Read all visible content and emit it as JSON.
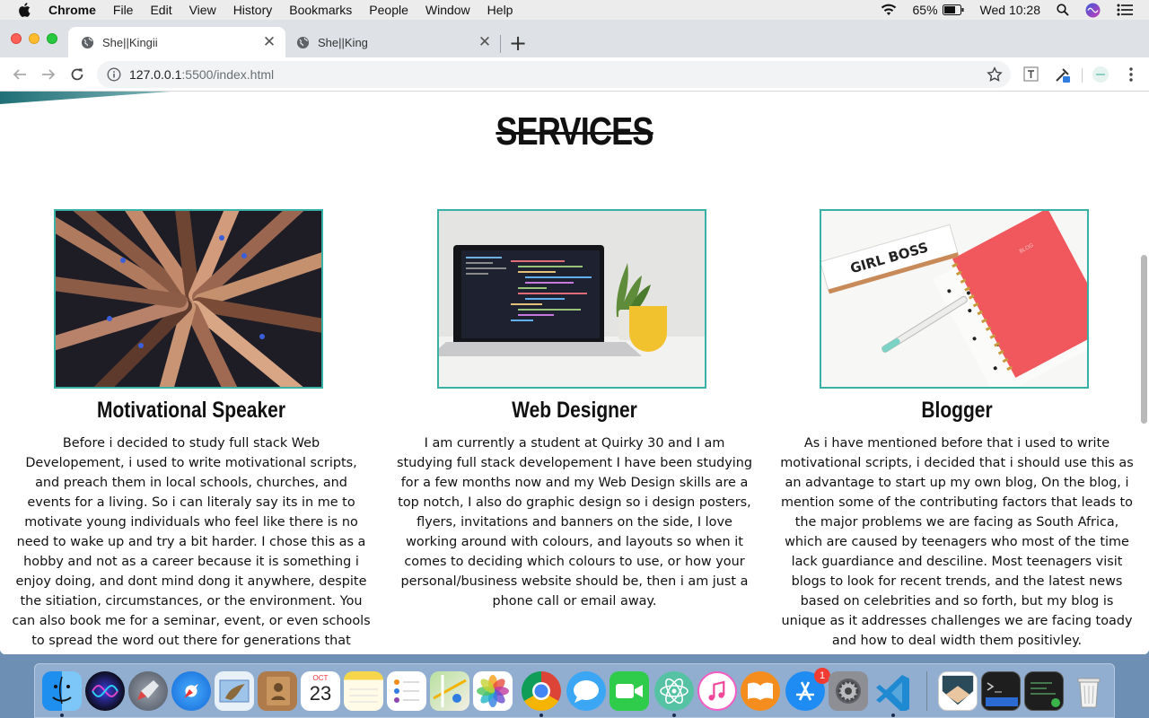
{
  "menubar": {
    "app": "Chrome",
    "items": [
      "File",
      "Edit",
      "View",
      "History",
      "Bookmarks",
      "People",
      "Window",
      "Help"
    ],
    "battery": "65%",
    "clock": "Wed 10:28"
  },
  "browser": {
    "tabs": [
      {
        "title": "She||Kingii",
        "active": true
      },
      {
        "title": "She||King",
        "active": false
      }
    ],
    "url_host": "127.0.0.1",
    "url_rest": ":5500/index.html"
  },
  "page": {
    "section_title": "SERVICES",
    "cards": [
      {
        "title": "Motivational Speaker",
        "image": "hands-together-photo",
        "lines": [
          "Before i decided to study full stack Web",
          "Developement, i used to write motivational scripts,",
          "and preach them in local schools, churches, and",
          "events for a living. So i can literaly say its in me to",
          "motivate young individuals who feel like there is no",
          "need to wake up and try a bit harder. I chose this as a",
          "hobby and not as a career because it is something i",
          "enjoy doing, and dont mind dong it anywhere, despite",
          "the sitiation, circumstances, or the environment. You",
          "can also book me for a seminar, event, or even schools",
          "to spread the word out there for generations that"
        ]
      },
      {
        "title": "Web Designer",
        "image": "laptop-code-photo",
        "lines": [
          "I am currently a student at Quirky 30 and I am",
          "studying full stack developement I have been studying",
          "for a few months now and my Web Design skills are a",
          "top notch, I also do graphic design so i design posters,",
          "flyers, invitations and banners on the side, I love",
          "working around with colours, and layouts so when it",
          "comes to deciding which colours to use, or how your",
          "personal/business website should be, then i am just a",
          "phone call or email away."
        ]
      },
      {
        "title": "Blogger",
        "image": "girl-boss-notebook-photo",
        "lines": [
          "As i have mentioned before that i used to write",
          "motivational scripts, i decided that i should use this as",
          "an advantage to start up my own blog, On the blog, i",
          "mention some of the contributing factors that leads to",
          "the major problems we are facing as South Africa,",
          "which are caused by teenagers who most of the time",
          "lack guardiance and desciline. Most teenagers visit",
          "blogs to look for recent trends, and the latest news",
          "based on celebrities and so forth, but my blog is",
          "unique as it addresses challenges we are facing toady",
          "and how to deal width them positivley."
        ]
      }
    ],
    "image_text": {
      "desk_sign": "GIRL BOSS",
      "notebook": "BLOG"
    }
  },
  "dock": {
    "apps": [
      "Finder",
      "Siri",
      "Launchpad",
      "Safari",
      "Mail",
      "Contacts",
      "Calendar",
      "Notes",
      "Reminders",
      "Maps",
      "Photos",
      "Google Chrome",
      "Messages",
      "FaceTime",
      "Atom",
      "iTunes",
      "iBooks",
      "App Store",
      "System Preferences",
      "Visual Studio Code",
      "Preview",
      "Terminal",
      "Terminal 2",
      "Trash"
    ],
    "calendar_month": "OCT",
    "calendar_day": "23",
    "appstore_badge": "1"
  },
  "colors": {
    "accent": "#38b2a7",
    "page_bg": "#ffffff",
    "tabstrip": "#dee1e6"
  }
}
